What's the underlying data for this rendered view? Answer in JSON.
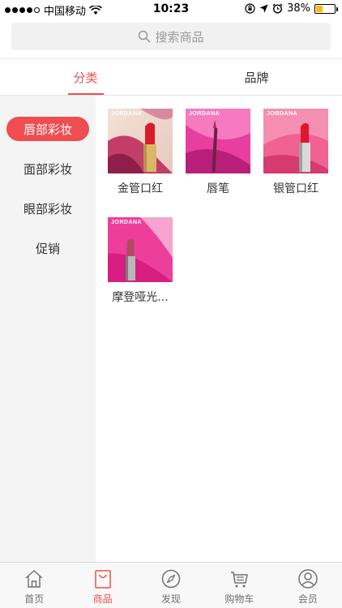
{
  "status_bar": {
    "carrier": "中国移动",
    "time": "10:23",
    "battery": "38%",
    "battery_level": 0.38
  },
  "search": {
    "placeholder": "搜索商品"
  },
  "tabs": [
    {
      "label": "分类",
      "active": true
    },
    {
      "label": "品牌",
      "active": false
    }
  ],
  "sidebar": {
    "items": [
      {
        "label": "唇部彩妆",
        "active": true
      },
      {
        "label": "面部彩妆",
        "active": false
      },
      {
        "label": "眼部彩妆",
        "active": false
      },
      {
        "label": "促销",
        "active": false
      }
    ]
  },
  "products": [
    {
      "name": "金管口红",
      "brand": "JORDANA",
      "image": "gold-lipstick"
    },
    {
      "name": "唇笔",
      "brand": "JORDANA",
      "image": "lip-pencil"
    },
    {
      "name": "银管口红",
      "brand": "JORDANA",
      "image": "silver-lipstick"
    },
    {
      "name": "摩登哑光...",
      "brand": "JORDANA",
      "image": "matte-lipstick"
    }
  ],
  "tabbar": {
    "items": [
      {
        "label": "首页",
        "icon": "home-icon",
        "active": false
      },
      {
        "label": "商品",
        "icon": "bag-icon",
        "active": true
      },
      {
        "label": "发现",
        "icon": "compass-icon",
        "active": false
      },
      {
        "label": "购物车",
        "icon": "cart-icon",
        "active": false
      },
      {
        "label": "会员",
        "icon": "user-icon",
        "active": false
      }
    ]
  },
  "colors": {
    "accent": "#ef4d4f",
    "sidebar_bg": "#f4f4f4",
    "battery": "#f5c000"
  }
}
